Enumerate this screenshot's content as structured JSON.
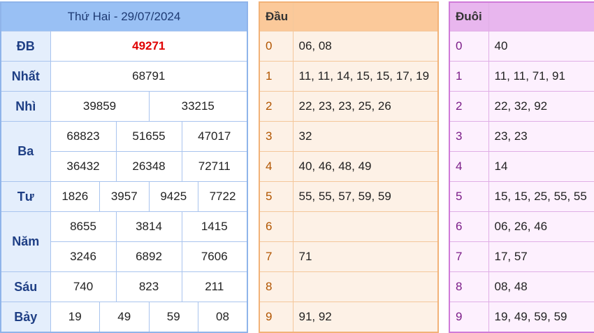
{
  "results": {
    "title": "Thứ Hai - 29/07/2024",
    "prizes": {
      "db": {
        "label": "ĐB",
        "values": [
          "49271"
        ]
      },
      "nhat": {
        "label": "Nhất",
        "values": [
          "68791"
        ]
      },
      "nhi": {
        "label": "Nhì",
        "values": [
          "39859",
          "33215"
        ]
      },
      "ba": {
        "label": "Ba",
        "values": [
          "68823",
          "51655",
          "47017",
          "36432",
          "26348",
          "72711"
        ]
      },
      "tu": {
        "label": "Tư",
        "values": [
          "1826",
          "3957",
          "9425",
          "7722"
        ]
      },
      "nam": {
        "label": "Năm",
        "values": [
          "8655",
          "3814",
          "1415",
          "3246",
          "6892",
          "7606"
        ]
      },
      "sau": {
        "label": "Sáu",
        "values": [
          "740",
          "823",
          "211"
        ]
      },
      "bay": {
        "label": "Bảy",
        "values": [
          "19",
          "49",
          "59",
          "08"
        ]
      }
    },
    "special_color": "#e00000"
  },
  "dau": {
    "header": "Đầu",
    "rows": [
      {
        "digit": "0",
        "list": "06, 08"
      },
      {
        "digit": "1",
        "list": "11, 11, 14, 15, 15, 17, 19"
      },
      {
        "digit": "2",
        "list": "22, 23, 23, 25, 26"
      },
      {
        "digit": "3",
        "list": "32"
      },
      {
        "digit": "4",
        "list": "40, 46, 48, 49"
      },
      {
        "digit": "5",
        "list": "55, 55, 57, 59, 59"
      },
      {
        "digit": "6",
        "list": ""
      },
      {
        "digit": "7",
        "list": "71"
      },
      {
        "digit": "8",
        "list": ""
      },
      {
        "digit": "9",
        "list": "91, 92"
      }
    ]
  },
  "duoi": {
    "header": "Đuôi",
    "rows": [
      {
        "digit": "0",
        "list": "40"
      },
      {
        "digit": "1",
        "list": "11, 11, 71, 91"
      },
      {
        "digit": "2",
        "list": "22, 32, 92"
      },
      {
        "digit": "3",
        "list": "23, 23"
      },
      {
        "digit": "4",
        "list": "14"
      },
      {
        "digit": "5",
        "list": "15, 15, 25, 55, 55"
      },
      {
        "digit": "6",
        "list": "06, 26, 46"
      },
      {
        "digit": "7",
        "list": "17, 57"
      },
      {
        "digit": "8",
        "list": "08, 48"
      },
      {
        "digit": "9",
        "list": "19, 49, 59, 59"
      }
    ]
  }
}
